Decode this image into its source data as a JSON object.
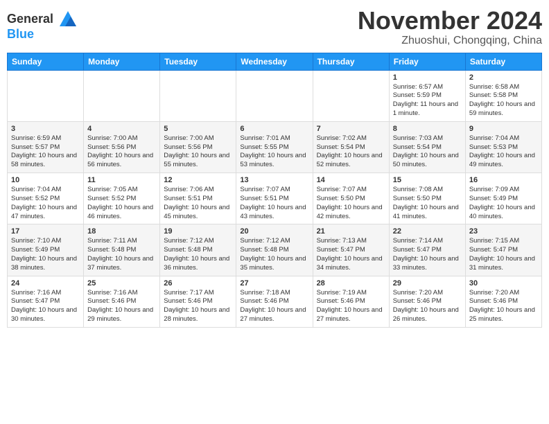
{
  "header": {
    "logo_general": "General",
    "logo_blue": "Blue",
    "month_title": "November 2024",
    "subtitle": "Zhuoshui, Chongqing, China"
  },
  "weekdays": [
    "Sunday",
    "Monday",
    "Tuesday",
    "Wednesday",
    "Thursday",
    "Friday",
    "Saturday"
  ],
  "weeks": [
    [
      {
        "day": "",
        "info": ""
      },
      {
        "day": "",
        "info": ""
      },
      {
        "day": "",
        "info": ""
      },
      {
        "day": "",
        "info": ""
      },
      {
        "day": "",
        "info": ""
      },
      {
        "day": "1",
        "info": "Sunrise: 6:57 AM\nSunset: 5:59 PM\nDaylight: 11 hours and 1 minute."
      },
      {
        "day": "2",
        "info": "Sunrise: 6:58 AM\nSunset: 5:58 PM\nDaylight: 10 hours and 59 minutes."
      }
    ],
    [
      {
        "day": "3",
        "info": "Sunrise: 6:59 AM\nSunset: 5:57 PM\nDaylight: 10 hours and 58 minutes."
      },
      {
        "day": "4",
        "info": "Sunrise: 7:00 AM\nSunset: 5:56 PM\nDaylight: 10 hours and 56 minutes."
      },
      {
        "day": "5",
        "info": "Sunrise: 7:00 AM\nSunset: 5:56 PM\nDaylight: 10 hours and 55 minutes."
      },
      {
        "day": "6",
        "info": "Sunrise: 7:01 AM\nSunset: 5:55 PM\nDaylight: 10 hours and 53 minutes."
      },
      {
        "day": "7",
        "info": "Sunrise: 7:02 AM\nSunset: 5:54 PM\nDaylight: 10 hours and 52 minutes."
      },
      {
        "day": "8",
        "info": "Sunrise: 7:03 AM\nSunset: 5:54 PM\nDaylight: 10 hours and 50 minutes."
      },
      {
        "day": "9",
        "info": "Sunrise: 7:04 AM\nSunset: 5:53 PM\nDaylight: 10 hours and 49 minutes."
      }
    ],
    [
      {
        "day": "10",
        "info": "Sunrise: 7:04 AM\nSunset: 5:52 PM\nDaylight: 10 hours and 47 minutes."
      },
      {
        "day": "11",
        "info": "Sunrise: 7:05 AM\nSunset: 5:52 PM\nDaylight: 10 hours and 46 minutes."
      },
      {
        "day": "12",
        "info": "Sunrise: 7:06 AM\nSunset: 5:51 PM\nDaylight: 10 hours and 45 minutes."
      },
      {
        "day": "13",
        "info": "Sunrise: 7:07 AM\nSunset: 5:51 PM\nDaylight: 10 hours and 43 minutes."
      },
      {
        "day": "14",
        "info": "Sunrise: 7:07 AM\nSunset: 5:50 PM\nDaylight: 10 hours and 42 minutes."
      },
      {
        "day": "15",
        "info": "Sunrise: 7:08 AM\nSunset: 5:50 PM\nDaylight: 10 hours and 41 minutes."
      },
      {
        "day": "16",
        "info": "Sunrise: 7:09 AM\nSunset: 5:49 PM\nDaylight: 10 hours and 40 minutes."
      }
    ],
    [
      {
        "day": "17",
        "info": "Sunrise: 7:10 AM\nSunset: 5:49 PM\nDaylight: 10 hours and 38 minutes."
      },
      {
        "day": "18",
        "info": "Sunrise: 7:11 AM\nSunset: 5:48 PM\nDaylight: 10 hours and 37 minutes."
      },
      {
        "day": "19",
        "info": "Sunrise: 7:12 AM\nSunset: 5:48 PM\nDaylight: 10 hours and 36 minutes."
      },
      {
        "day": "20",
        "info": "Sunrise: 7:12 AM\nSunset: 5:48 PM\nDaylight: 10 hours and 35 minutes."
      },
      {
        "day": "21",
        "info": "Sunrise: 7:13 AM\nSunset: 5:47 PM\nDaylight: 10 hours and 34 minutes."
      },
      {
        "day": "22",
        "info": "Sunrise: 7:14 AM\nSunset: 5:47 PM\nDaylight: 10 hours and 33 minutes."
      },
      {
        "day": "23",
        "info": "Sunrise: 7:15 AM\nSunset: 5:47 PM\nDaylight: 10 hours and 31 minutes."
      }
    ],
    [
      {
        "day": "24",
        "info": "Sunrise: 7:16 AM\nSunset: 5:47 PM\nDaylight: 10 hours and 30 minutes."
      },
      {
        "day": "25",
        "info": "Sunrise: 7:16 AM\nSunset: 5:46 PM\nDaylight: 10 hours and 29 minutes."
      },
      {
        "day": "26",
        "info": "Sunrise: 7:17 AM\nSunset: 5:46 PM\nDaylight: 10 hours and 28 minutes."
      },
      {
        "day": "27",
        "info": "Sunrise: 7:18 AM\nSunset: 5:46 PM\nDaylight: 10 hours and 27 minutes."
      },
      {
        "day": "28",
        "info": "Sunrise: 7:19 AM\nSunset: 5:46 PM\nDaylight: 10 hours and 27 minutes."
      },
      {
        "day": "29",
        "info": "Sunrise: 7:20 AM\nSunset: 5:46 PM\nDaylight: 10 hours and 26 minutes."
      },
      {
        "day": "30",
        "info": "Sunrise: 7:20 AM\nSunset: 5:46 PM\nDaylight: 10 hours and 25 minutes."
      }
    ]
  ]
}
